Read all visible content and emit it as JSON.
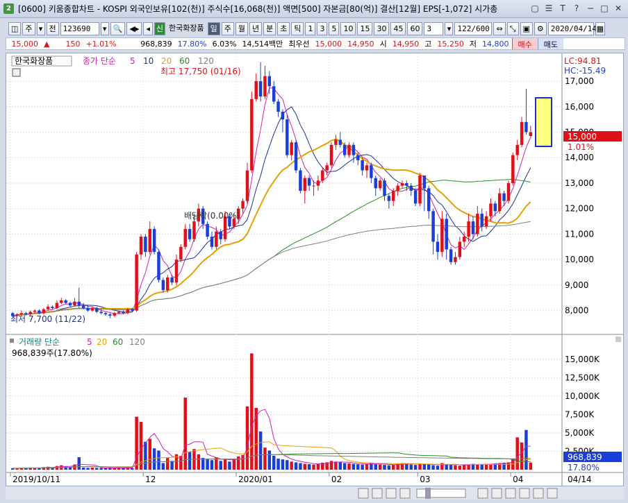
{
  "window": {
    "icon": "2",
    "title": "[0600] 키움종합차트 - KOSPI 외국인보유[102(천)] 주식수[16,068(천)] 액면[500] 자본금[80(억)] 결산[12월] EPS[-1,072] 시가총"
  },
  "toolbar": {
    "period_label": "주",
    "jeon_label": "전",
    "code_value": "123690",
    "shin_label": "신",
    "stock_name": "한국화장품",
    "periods": [
      "일",
      "주",
      "월",
      "년",
      "분",
      "초",
      "틱"
    ],
    "minutes": [
      "1",
      "3",
      "5",
      "10",
      "15",
      "30",
      "45",
      "60"
    ],
    "count_select": "3",
    "page_count": "122/600",
    "date_value": "2020/04/14"
  },
  "infobar": {
    "price": "15,000",
    "change_arrow": "▲",
    "change": "150",
    "change_pct": "+1.01%",
    "volume": "968,839",
    "turnover_pct": "17.80%",
    "ratio": "6.03%",
    "trade_amount": "14,514백만",
    "best_bid_label": "최우선",
    "best_bid": "15,000",
    "best_bid2": "14,950",
    "open_label": "시",
    "open": "14,950",
    "high_label": "고",
    "high": "15,250",
    "low_label": "저",
    "low": "14,800",
    "buy_label": "매수",
    "sell_label": "매도"
  },
  "price_panel": {
    "stock_tab": "한국화장품",
    "legend_prefix": "종가 단순",
    "ma_labels": [
      "5",
      "10",
      "20",
      "60",
      "120"
    ],
    "ma_colors": [
      "#d020b0",
      "#1a2fa0",
      "#e8a000",
      "#2a8a2a",
      "#808080"
    ],
    "max_label": "최고 17,750 (01/16)",
    "min_label": "최저 7,700 (11/22)",
    "dividend_label": "배당락(0.00%)",
    "lc_label": "LC:94.81",
    "hc_label": "HC:-15.49",
    "current_price_tag": "15,000",
    "current_pct_tag": "1.01%",
    "y_ticks": [
      "17,000",
      "16,000",
      "15,000",
      "14,000",
      "13,000",
      "12,000",
      "11,000",
      "10,000",
      "9,000",
      "8,000"
    ]
  },
  "volume_panel": {
    "title": "거래량 단순",
    "ma_labels": [
      "5",
      "20",
      "60",
      "120"
    ],
    "value_label": "968,839주(17.80%)",
    "current_tag": "968,839",
    "current_pct": "17.80%",
    "y_ticks": [
      "15,000K",
      "12,500K",
      "10,000K",
      "7,500K",
      "5,000K",
      "2,500K"
    ]
  },
  "x_axis": {
    "labels": [
      "2019/10/11",
      "12",
      "2020/01",
      "02",
      "03",
      "04"
    ],
    "right_label": "04/14"
  },
  "chart_data": {
    "type": "candlestick",
    "price_range": [
      7200,
      17600
    ],
    "volume_range": [
      0,
      16500
    ],
    "candles": [
      [
        7900,
        7800,
        7950,
        7750
      ],
      [
        7800,
        7850,
        7900,
        7750
      ],
      [
        7850,
        7900,
        8000,
        7800
      ],
      [
        7900,
        7850,
        7950,
        7800
      ],
      [
        7850,
        7950,
        8000,
        7800
      ],
      [
        7950,
        8000,
        8050,
        7900
      ],
      [
        8000,
        7900,
        8050,
        7850
      ],
      [
        7900,
        8050,
        8100,
        7850
      ],
      [
        8050,
        8150,
        8250,
        8000
      ],
      [
        8150,
        8100,
        8200,
        8050
      ],
      [
        8100,
        8300,
        8400,
        8050
      ],
      [
        8300,
        8400,
        8500,
        8250
      ],
      [
        8400,
        8300,
        8450,
        8250
      ],
      [
        8300,
        8200,
        8350,
        8150
      ],
      [
        8200,
        8350,
        8500,
        8150
      ],
      [
        8350,
        8200,
        8900,
        8100
      ],
      [
        8200,
        8100,
        8300,
        8050
      ],
      [
        8100,
        8000,
        8200,
        7950
      ],
      [
        8000,
        8100,
        8150,
        7950
      ],
      [
        8100,
        7950,
        8150,
        7900
      ],
      [
        7950,
        7900,
        8050,
        7850
      ],
      [
        7900,
        7850,
        7950,
        7800
      ],
      [
        7850,
        7800,
        7900,
        7700
      ],
      [
        7800,
        7900,
        7950,
        7750
      ],
      [
        7900,
        7950,
        8000,
        7850
      ],
      [
        7950,
        7900,
        8000,
        7850
      ],
      [
        7900,
        8050,
        8100,
        7850
      ],
      [
        8050,
        8000,
        8100,
        7950
      ],
      [
        8000,
        10200,
        10300,
        7950
      ],
      [
        10200,
        10900,
        11000,
        10000
      ],
      [
        10900,
        10300,
        11000,
        10100
      ],
      [
        10300,
        11200,
        11500,
        10200
      ],
      [
        11200,
        10300,
        11300,
        10200
      ],
      [
        10300,
        9200,
        10400,
        9100
      ],
      [
        9200,
        8800,
        9300,
        8700
      ],
      [
        8800,
        9300,
        9400,
        8700
      ],
      [
        9300,
        9100,
        9400,
        9000
      ],
      [
        9100,
        10000,
        10200,
        9000
      ],
      [
        10000,
        10500,
        10600,
        9900
      ],
      [
        10500,
        11200,
        11400,
        10400
      ],
      [
        11200,
        10800,
        11400,
        10700
      ],
      [
        10800,
        11500,
        11800,
        10700
      ],
      [
        11500,
        12000,
        12200,
        11300
      ],
      [
        12000,
        11400,
        12100,
        11200
      ],
      [
        11400,
        10900,
        11500,
        10800
      ],
      [
        10900,
        10500,
        11100,
        10400
      ],
      [
        10500,
        11100,
        11300,
        10400
      ],
      [
        11100,
        10800,
        11200,
        10600
      ],
      [
        10800,
        11700,
        11900,
        10700
      ],
      [
        11700,
        11300,
        11800,
        11200
      ],
      [
        11300,
        11600,
        11800,
        11200
      ],
      [
        11600,
        12000,
        12100,
        11400
      ],
      [
        12000,
        12300,
        12400,
        11800
      ],
      [
        12300,
        13500,
        13800,
        12200
      ],
      [
        13500,
        16300,
        16600,
        13400
      ],
      [
        16300,
        17000,
        17300,
        16200
      ],
      [
        17000,
        16400,
        17750,
        16200
      ],
      [
        16400,
        17200,
        17600,
        16300
      ],
      [
        17200,
        16800,
        17400,
        16500
      ],
      [
        16800,
        16200,
        17000,
        16100
      ],
      [
        16200,
        15800,
        16300,
        15600
      ],
      [
        15800,
        15500,
        15900,
        15000
      ],
      [
        15500,
        14100,
        15700,
        14000
      ],
      [
        14100,
        14600,
        14700,
        13900
      ],
      [
        14600,
        13500,
        14700,
        13400
      ],
      [
        13500,
        12700,
        13600,
        12600
      ],
      [
        12700,
        13200,
        13300,
        12200
      ],
      [
        13200,
        12900,
        13300,
        12700
      ],
      [
        12900,
        12900,
        13100,
        12500
      ],
      [
        12900,
        13100,
        13300,
        12700
      ],
      [
        13100,
        13500,
        13600,
        13000
      ],
      [
        13500,
        13700,
        13800,
        13300
      ],
      [
        13700,
        14500,
        14600,
        13600
      ],
      [
        14500,
        14700,
        14900,
        14300
      ],
      [
        14700,
        14500,
        15000,
        14400
      ],
      [
        14500,
        14100,
        14600,
        14000
      ],
      [
        14100,
        14500,
        14600,
        14000
      ],
      [
        14500,
        14100,
        14600,
        13800
      ],
      [
        14100,
        13900,
        14200,
        13700
      ],
      [
        13900,
        13500,
        14000,
        13300
      ],
      [
        13500,
        13700,
        13800,
        13200
      ],
      [
        13700,
        13200,
        13800,
        13000
      ],
      [
        13200,
        12800,
        13300,
        12500
      ],
      [
        12800,
        13100,
        13200,
        12700
      ],
      [
        13100,
        12500,
        13200,
        12300
      ],
      [
        12500,
        12300,
        12600,
        12000
      ],
      [
        12300,
        12700,
        12800,
        12100
      ],
      [
        12700,
        12900,
        13000,
        12500
      ],
      [
        12900,
        13000,
        13100,
        12800
      ],
      [
        13000,
        12900,
        13100,
        12700
      ],
      [
        12900,
        12700,
        13000,
        12500
      ],
      [
        12700,
        12200,
        12800,
        12100
      ],
      [
        12200,
        13300,
        13400,
        12100
      ],
      [
        13300,
        12800,
        13300,
        11900
      ],
      [
        12800,
        11900,
        12900,
        11600
      ],
      [
        11900,
        10700,
        12000,
        10200
      ],
      [
        10700,
        10300,
        11000,
        10000
      ],
      [
        10300,
        11600,
        11900,
        10100
      ],
      [
        11600,
        10400,
        11800,
        10000
      ],
      [
        10400,
        9900,
        10500,
        9800
      ],
      [
        9900,
        10100,
        10300,
        9800
      ],
      [
        10100,
        10700,
        10900,
        10000
      ],
      [
        10700,
        10900,
        11100,
        10500
      ],
      [
        10900,
        11500,
        11800,
        10700
      ],
      [
        11500,
        11000,
        11700,
        10800
      ],
      [
        11000,
        11800,
        12100,
        10900
      ],
      [
        11800,
        11300,
        12000,
        11100
      ],
      [
        11300,
        11700,
        11900,
        11200
      ],
      [
        11700,
        12200,
        12400,
        11500
      ],
      [
        12200,
        11900,
        12300,
        11700
      ],
      [
        11900,
        12600,
        12800,
        11800
      ],
      [
        12600,
        12300,
        12700,
        12100
      ],
      [
        12300,
        13000,
        13100,
        12200
      ],
      [
        13000,
        14100,
        14200,
        12900
      ],
      [
        14100,
        14500,
        14700,
        13900
      ],
      [
        14500,
        15400,
        15600,
        14400
      ],
      [
        15400,
        15000,
        16700,
        14900
      ],
      [
        14850,
        15000,
        15250,
        14800
      ]
    ],
    "volumes": [
      200,
      180,
      260,
      220,
      300,
      250,
      210,
      350,
      400,
      280,
      500,
      600,
      450,
      380,
      700,
      1700,
      300,
      250,
      280,
      240,
      220,
      200,
      300,
      260,
      240,
      220,
      250,
      230,
      7200,
      6500,
      3800,
      4200,
      2900,
      2600,
      900,
      1600,
      1200,
      2100,
      1900,
      9800,
      2400,
      2800,
      2100,
      1600,
      1500,
      1300,
      1700,
      1200,
      1400,
      1100,
      1500,
      1800,
      2000,
      8600,
      15800,
      8400,
      5200,
      3000,
      2600,
      1900,
      1500,
      1400,
      1300,
      1100,
      1000,
      900,
      800,
      750,
      700,
      800,
      950,
      1000,
      1200,
      1100,
      1000,
      900,
      850,
      800,
      750,
      700,
      800,
      900,
      750,
      700,
      650,
      600,
      700,
      800,
      900,
      850,
      700,
      650,
      800,
      750,
      700,
      600,
      550,
      900,
      700,
      650,
      600,
      550,
      700,
      750,
      800,
      700,
      750,
      700,
      800,
      850,
      900,
      950,
      1000,
      1500,
      4400,
      3700,
      5400,
      969
    ]
  }
}
